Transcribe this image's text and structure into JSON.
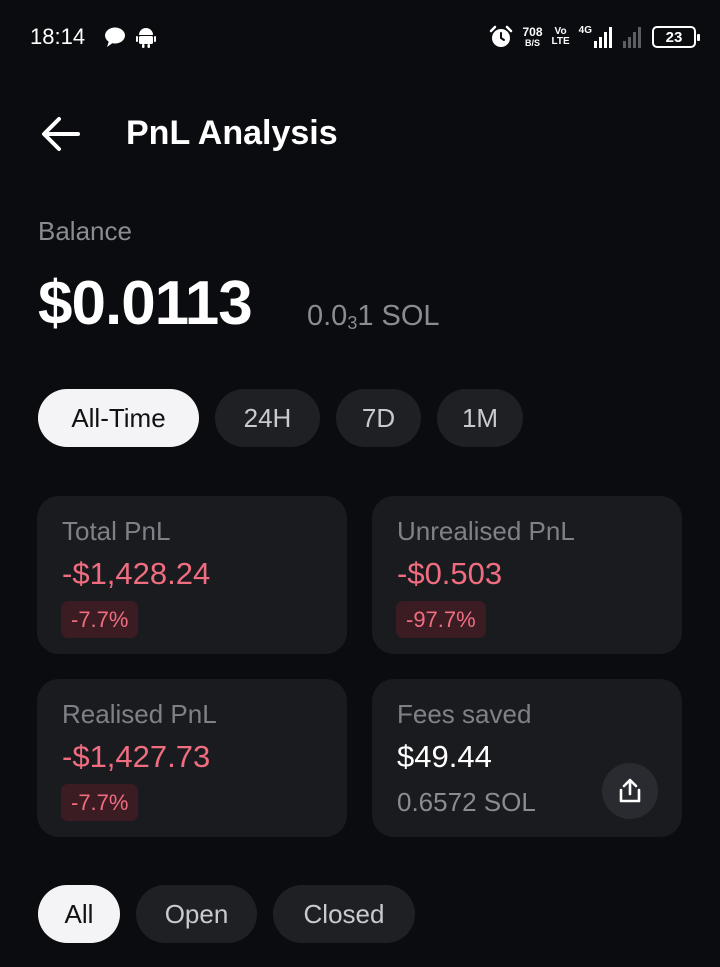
{
  "status_bar": {
    "time": "18:14",
    "net_speed_value": "708",
    "net_speed_unit": "B/S",
    "volte_top": "Vo",
    "volte_bottom": "LTE",
    "network_type": "4G",
    "battery": "23"
  },
  "header": {
    "title": "PnL Analysis"
  },
  "balance": {
    "label": "Balance",
    "usd": "$0.0113",
    "sol_prefix": "0.0",
    "sol_subscript": "3",
    "sol_suffix": "1 SOL"
  },
  "time_filters": [
    {
      "label": "All-Time",
      "active": true
    },
    {
      "label": "24H",
      "active": false
    },
    {
      "label": "7D",
      "active": false
    },
    {
      "label": "1M",
      "active": false
    }
  ],
  "cards": {
    "total_pnl": {
      "label": "Total PnL",
      "value": "-$1,428.24",
      "pct": "-7.7%"
    },
    "unrealised_pnl": {
      "label": "Unrealised PnL",
      "value": "-$0.503",
      "pct": "-97.7%"
    },
    "realised_pnl": {
      "label": "Realised PnL",
      "value": "-$1,427.73",
      "pct": "-7.7%"
    },
    "fees_saved": {
      "label": "Fees saved",
      "value": "$49.44",
      "sub": "0.6572 SOL"
    }
  },
  "position_filters": [
    {
      "label": "All",
      "active": true
    },
    {
      "label": "Open",
      "active": false
    },
    {
      "label": "Closed",
      "active": false
    }
  ],
  "colors": {
    "background": "#0b0c0f",
    "card": "#1a1b1f",
    "negative": "#f06d80",
    "muted": "#8a8c93",
    "chip_active": "#f4f4f6"
  },
  "icons": {
    "back": "arrow-left-icon",
    "share": "share-icon",
    "alarm": "alarm-icon",
    "chat": "chat-bubble-icon",
    "android": "android-icon",
    "signal": "signal-icon"
  }
}
